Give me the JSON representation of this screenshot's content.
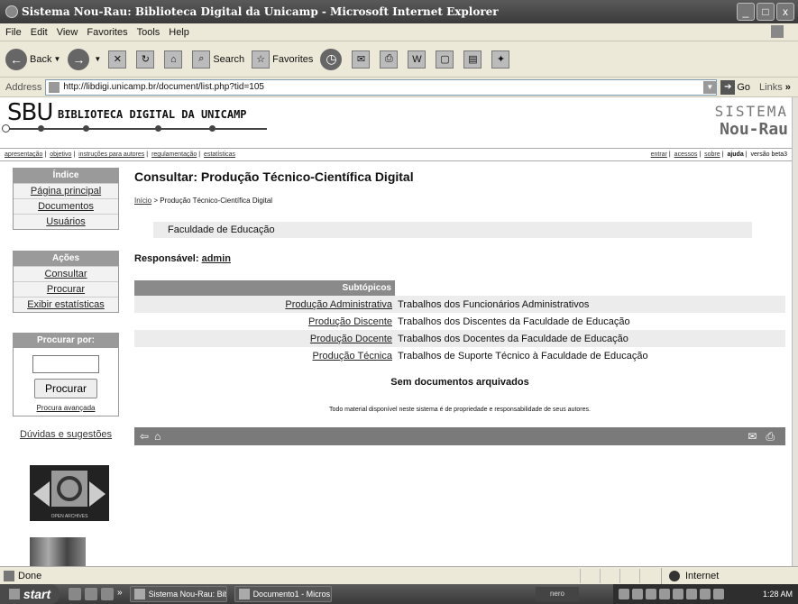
{
  "window": {
    "title": "Sistema Nou-Rau: Biblioteca Digital da Unicamp - Microsoft Internet Explorer",
    "controls": [
      "_",
      "□",
      "x"
    ]
  },
  "menu": [
    "File",
    "Edit",
    "View",
    "Favorites",
    "Tools",
    "Help"
  ],
  "toolbar": {
    "back": "Back",
    "search": "Search",
    "favorites": "Favorites"
  },
  "address": {
    "label": "Address",
    "url": "http://libdigi.unicamp.br/document/list.php?tid=105",
    "go": "Go",
    "links": "Links"
  },
  "header": {
    "logo": "SBU",
    "name": "BIBLIOTECA DIGITAL DA UNICAMP",
    "sistema": "SISTEMA",
    "nourau": "Nou-Rau"
  },
  "topnav": {
    "left": [
      "apresentação",
      "objetivo",
      "instruções para autores",
      "regulamentação",
      "estatísticas"
    ],
    "right_links": [
      "entrar",
      "acessos",
      "sobre"
    ],
    "right_bold": "ajuda",
    "version": "versão beta3"
  },
  "sidebar": {
    "indice": {
      "title": "Índice",
      "items": [
        "Página principal",
        "Documentos",
        "Usuários"
      ]
    },
    "acoes": {
      "title": "Ações",
      "items": [
        "Consultar",
        "Procurar",
        "Exibir estatísticas"
      ]
    },
    "procurar": {
      "title": "Procurar por:",
      "button": "Procurar",
      "advanced": "Procura avançada"
    },
    "duvidas": "Dúvidas e sugestões",
    "open_archives": "OPEN ARCHIVES"
  },
  "main": {
    "title": "Consultar: Produção Técnico-Científica Digital",
    "breadcrumb_link": "Início",
    "breadcrumb_rest": " > Produção Técnico-Científica Digital",
    "faculty": "Faculdade de Educação",
    "responsavel_label": "Responsável:",
    "responsavel_user": "admin",
    "subtopics_header": "Subtópicos",
    "subtopics": [
      {
        "name": "Produção Administrativa",
        "desc": "Trabalhos dos Funcionários Administrativos"
      },
      {
        "name": "Produção Discente",
        "desc": "Trabalhos dos Discentes da Faculdade de Educação"
      },
      {
        "name": "Produção Docente",
        "desc": "Trabalhos dos Docentes da Faculdade de Educação"
      },
      {
        "name": "Produção Técnica",
        "desc": "Trabalhos de Suporte Técnico à Faculdade de Educação"
      }
    ],
    "sem_docs": "Sem documentos arquivados",
    "notice": "Todo material disponível neste sistema é de propriedade e responsabilidade de seus autores."
  },
  "status": {
    "text": "Done",
    "zone": "Internet"
  },
  "taskbar": {
    "start": "start",
    "tasks": [
      "Sistema Nou-Rau: Bib...",
      "Documento1 - Micros..."
    ],
    "nero": "nero",
    "clock": "1:28 AM"
  }
}
